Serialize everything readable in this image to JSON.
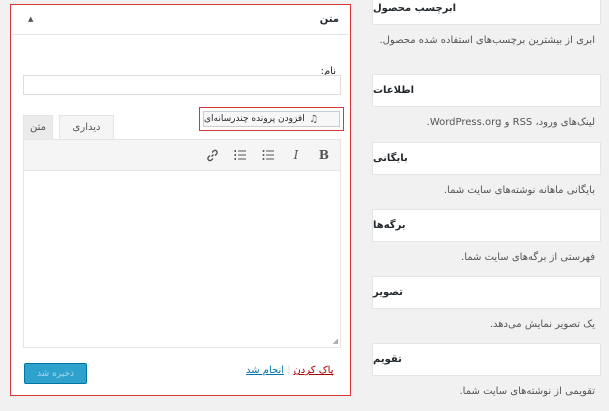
{
  "panel": {
    "title": "متن",
    "toggle_icon": "arrow-up-icon",
    "name_label": "نام:",
    "name_value": "",
    "add_media_label": "افزودن پرونده چندرسانه‌ای",
    "tabs": {
      "text": "متن",
      "visual": "دیداری"
    },
    "toolbar": {
      "bold": "B",
      "italic": "I"
    },
    "delete_label": "پاک کردن",
    "separator": "|",
    "done_label": "انجام شد",
    "save_label": "ذخیره شد"
  },
  "available_widgets": [
    {
      "title": "ابرچسب محصول",
      "desc": "ابری از بیشترین برچسب‌های استفاده شده محصول."
    },
    {
      "title": "اطلاعات",
      "desc": "لینک‌های ورود، RSS و WordPress.org."
    },
    {
      "title": "بایگانی",
      "desc": "بایگانی ماهانه نوشته‌های سایت شما."
    },
    {
      "title": "برگه‌ها",
      "desc": "فهرستی از برگه‌های سایت شما."
    },
    {
      "title": "تصویر",
      "desc": "یک تصویر نمایش می‌دهد."
    },
    {
      "title": "تقویم",
      "desc": "تقویمی از نوشته‌های سایت شما."
    }
  ],
  "colors": {
    "highlight": "#d63638",
    "primary_button": "#2ea2cc",
    "link": "#0073aa",
    "delete_link": "#a00"
  }
}
